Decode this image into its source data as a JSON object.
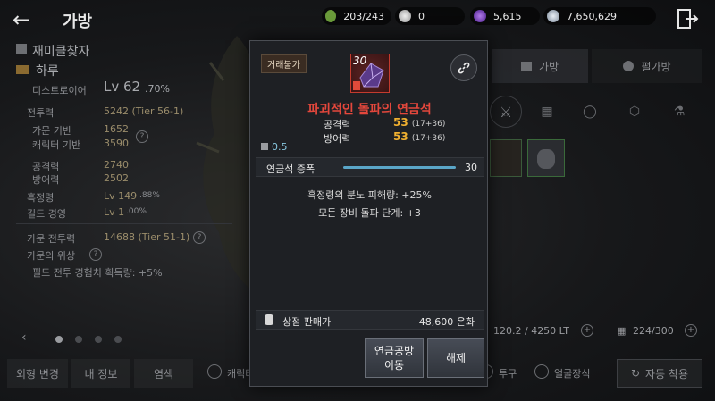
{
  "topbar": {
    "title": "가방",
    "stamina": "203/243",
    "pearls": "0",
    "crystals": "5,615",
    "silver": "7,650,629"
  },
  "profile": {
    "name": "재미클찾자",
    "guild": "하루",
    "class": "디스트로이어",
    "level": "Lv 62",
    "level_pct": ".70%",
    "combat_power_label": "전투력",
    "combat_power": "5242 (Tier 56-1)",
    "base_family_label": "가문 기반",
    "base_family": "1652",
    "base_char_label": "캐릭터 기반",
    "base_char": "3590",
    "attack_label": "공격력",
    "attack": "2740",
    "defense_label": "방어력",
    "defense": "2502",
    "black_spirit_label": "흑정령",
    "black_spirit": "Lv 149",
    "black_spirit_pct": ".88%",
    "guild_exp_label": "길드 경영",
    "guild_exp": "Lv 1",
    "guild_exp_pct": ".00%",
    "family_cp_label": "가문 전투력",
    "family_cp": "14688 (Tier 51-1)",
    "family_prestige_label": "가문의 위상",
    "family_bonus": "필드 전투 경험치 획득량: +5%"
  },
  "left_buttons": [
    "외형 변경",
    "내 정보",
    "염색"
  ],
  "right": {
    "tab_bag": "가방",
    "tab_pearl": "펄가방",
    "weight": "120.2 / 4250 LT",
    "slots": "224/300",
    "bottom_opts": [
      "캐릭터 외견",
      "투구",
      "얼굴장식"
    ],
    "auto_equip": "자동 착용"
  },
  "modal": {
    "trade_tag": "거래불가",
    "item_level": "30",
    "item_name": "파괴적인 돌파의 연금석",
    "attack_label": "공격력",
    "attack_val": "53",
    "attack_detail": "(17+36)",
    "defense_label": "방어력",
    "defense_val": "53",
    "defense_detail": "(17+36)",
    "weight": "0.5",
    "growth_label": "연금석 증폭",
    "growth_val": "30",
    "growth_fill": 1.0,
    "effect1": "흑정령의 분노 피해량: +25%",
    "effect2": "모든 장비 돌파 단계: +3",
    "price_label": "상점 판매가",
    "price_val": "48,600 은화",
    "btn_move": "연금공방\n이동",
    "btn_release": "해제"
  },
  "colors": {
    "accent_red": "#e4473c",
    "stat_gold": "#f0b030",
    "bar_blue": "#5aa6c8"
  }
}
